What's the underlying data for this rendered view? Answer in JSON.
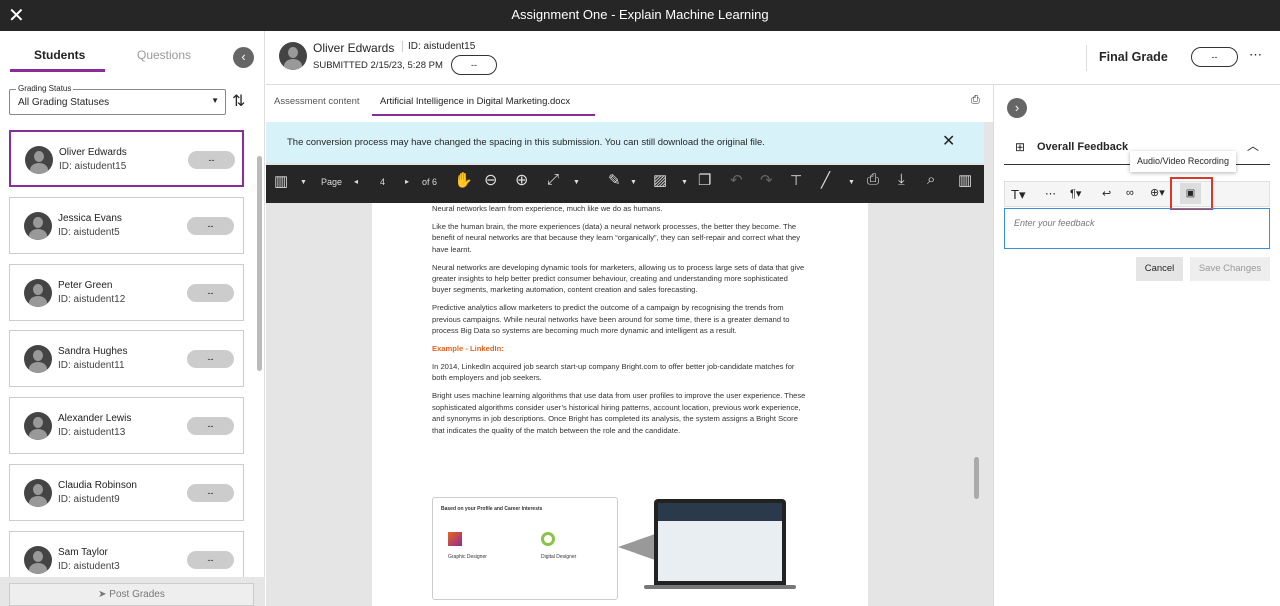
{
  "window": {
    "title": "Assignment One - Explain Machine Learning"
  },
  "left": {
    "tabs": [
      "Students",
      "Questions"
    ],
    "filter_label": "Grading Status",
    "filter_value": "All Grading Statuses",
    "post_grades": "Post Grades",
    "students": [
      {
        "name": "Oliver Edwards",
        "id": "ID: aistudent15",
        "grade": "--"
      },
      {
        "name": "Jessica Evans",
        "id": "ID: aistudent5",
        "grade": "--"
      },
      {
        "name": "Peter Green",
        "id": "ID: aistudent12",
        "grade": "--"
      },
      {
        "name": "Sandra Hughes",
        "id": "ID: aistudent11",
        "grade": "--"
      },
      {
        "name": "Alexander Lewis",
        "id": "ID: aistudent13",
        "grade": "--"
      },
      {
        "name": "Claudia Robinson",
        "id": "ID: aistudent9",
        "grade": "--"
      },
      {
        "name": "Sam Taylor",
        "id": "ID: aistudent3",
        "grade": "--"
      }
    ]
  },
  "header": {
    "name": "Oliver Edwards",
    "id": "ID: aistudent15",
    "submitted": "SUBMITTED 2/15/23, 5:28 PM",
    "grade": "--",
    "final_grade_label": "Final Grade",
    "final_grade": "--"
  },
  "doc_tabs": [
    "Assessment content",
    "Artificial Intelligence in Digital Marketing.docx"
  ],
  "banner": "The conversion process may have changed the spacing in this submission. You can still download the original file.",
  "viewer": {
    "page_label": "Page",
    "page": "4",
    "of": "of 6"
  },
  "document": {
    "paragraphs": [
      "Neural networks learn from experience, much like we do as humans.",
      "Like the human brain, the more experiences (data) a neural network processes, the better they become. The benefit of neural networks are that because they learn “organically”, they can self-repair and correct what they have learnt.",
      "Neural networks are developing dynamic tools for marketers, allowing us to process large sets of data that give greater insights to help better predict consumer behaviour, creating and understanding more sophisticated buyer segments, marketing automation, content creation and sales forecasting.",
      "Predictive analytics allow marketers to predict the outcome of a campaign by recognising the trends from previous campaigns. While neural networks have been around for some time, there is a greater demand to process Big Data so systems are becoming much more dynamic and intelligent as a result."
    ],
    "heading": "Example - LinkedIn:",
    "paragraphs2": [
      "In 2014, LinkedIn acquired job search start-up company Bright.com to offer better job-candidate matches for both employers and job seekers.",
      "Bright uses machine learning algorithms that use data from user profiles to improve the user experience. These sophisticated algorithms consider user’s historical hiring patterns, account location, previous work experience, and synonyms in job descriptions. Once Bright has completed its analysis, the system assigns a Bright Score that indicates the quality of the match between the role and the candidate."
    ],
    "figure": {
      "title": "Based on your Profile and Career Interests",
      "job1": "Graphic Designer",
      "job2": "Digital Designer"
    }
  },
  "feedback": {
    "title": "Overall Feedback",
    "tooltip": "Audio/Video Recording",
    "placeholder": "Enter your feedback",
    "cancel": "Cancel",
    "save": "Save Changes"
  },
  "colors": {
    "accent": "#8a2c9c",
    "highlight": "#d9382b",
    "banner": "#d7f2f8",
    "heading": "#e8631a"
  }
}
